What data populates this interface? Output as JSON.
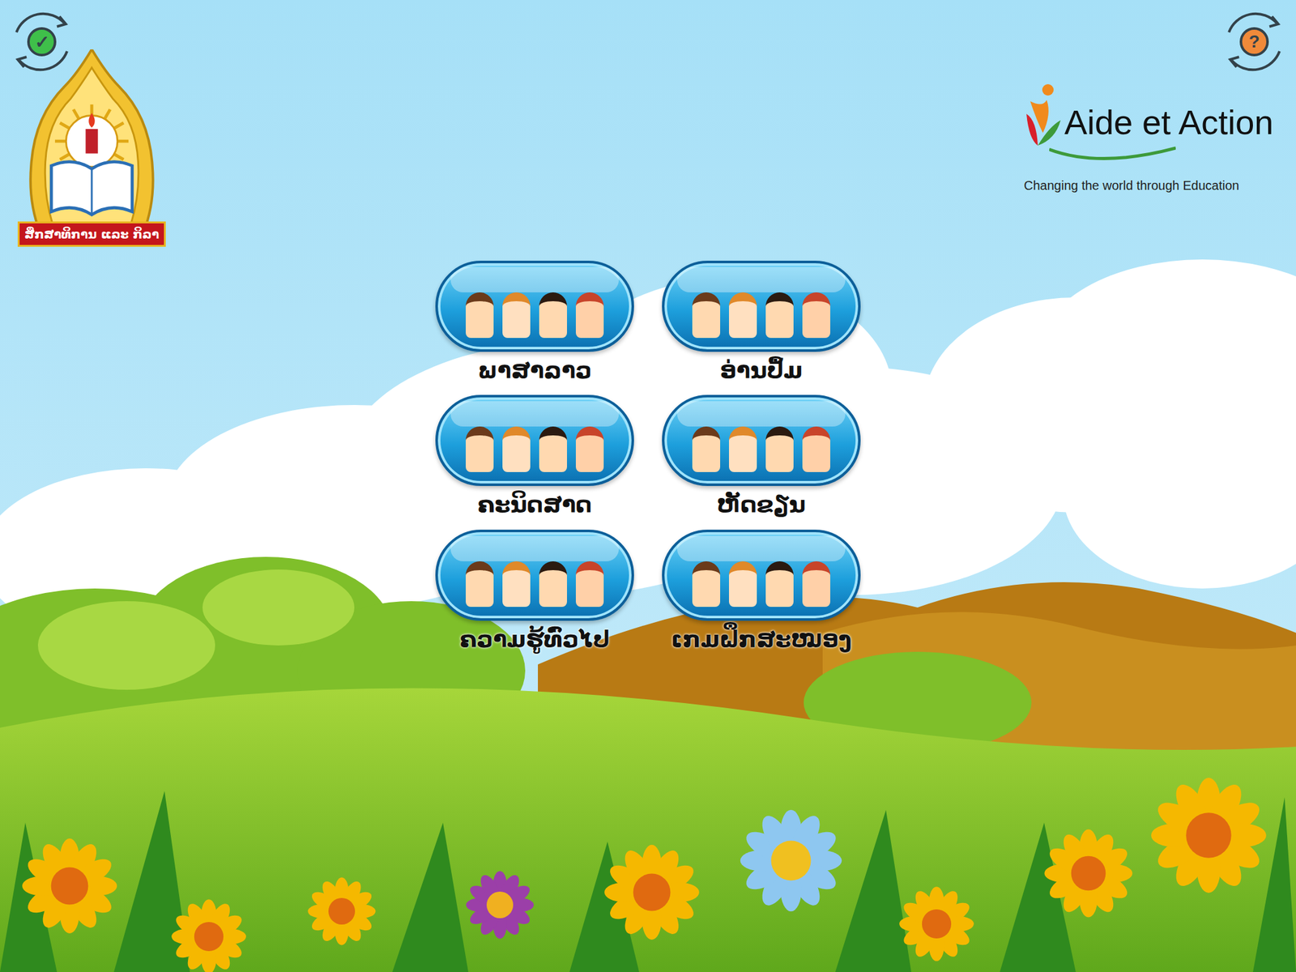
{
  "corner_buttons": {
    "confirm": {
      "glyph": "✓"
    },
    "help": {
      "glyph": "?"
    }
  },
  "header": {
    "emblem": {
      "banner": "ສຶກສາທິການ ແລະ ກິລາ"
    },
    "partner_logo": {
      "name": "Aide et Action",
      "tagline": "Changing the world through Education"
    }
  },
  "menu": [
    {
      "label": "ພາສາລາວ"
    },
    {
      "label": "ອ່ານປຶ້ມ"
    },
    {
      "label": "ຄະນິດສາດ"
    },
    {
      "label": "ຫັດຂຽນ"
    },
    {
      "label": "ຄວາມຮູ້ທົ່ວໄປ"
    },
    {
      "label": "ເກມຝຶກສະໝອງ"
    }
  ]
}
